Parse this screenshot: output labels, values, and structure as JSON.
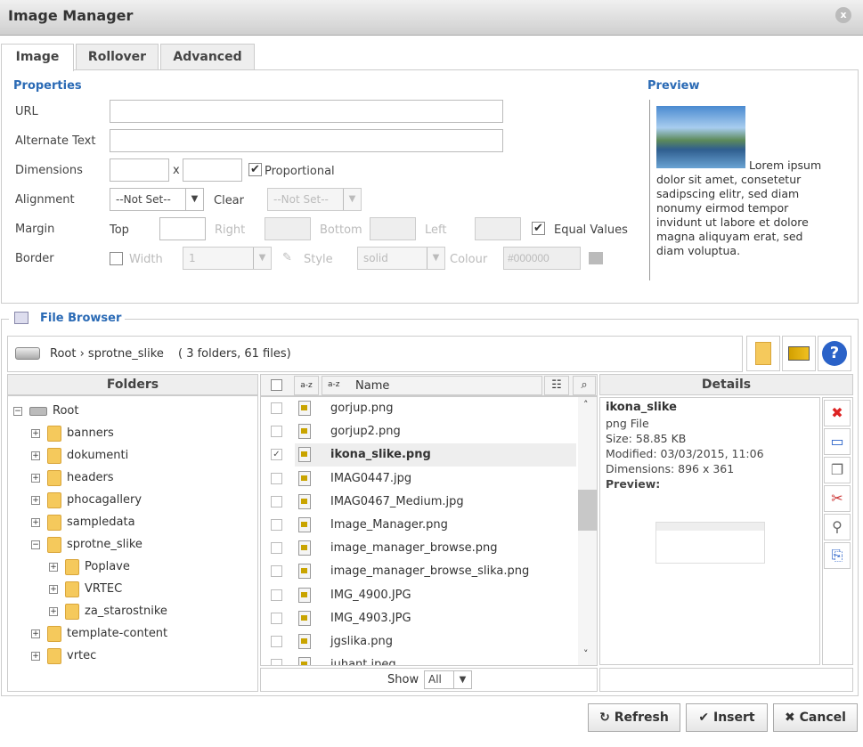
{
  "title": "Image Manager",
  "tabs": [
    "Image",
    "Rollover",
    "Advanced"
  ],
  "properties": {
    "heading": "Properties",
    "url_label": "URL",
    "url_value": "",
    "alt_label": "Alternate Text",
    "alt_value": "",
    "dimensions_label": "Dimensions",
    "width_value": "",
    "x": "x",
    "height_value": "",
    "proportional_label": "Proportional",
    "proportional_checked": true,
    "alignment_label": "Alignment",
    "alignment_value": "--Not Set--",
    "clear_label": "Clear",
    "clear_value": "--Not Set--",
    "margin_label": "Margin",
    "top": "Top",
    "right": "Right",
    "bottom": "Bottom",
    "left": "Left",
    "equal_values_label": "Equal Values",
    "equal_values_checked": true,
    "border_label": "Border",
    "border_checked": false,
    "width_label": "Width",
    "width_sel": "1",
    "style_label": "Style",
    "style_sel": "solid",
    "colour_label": "Colour",
    "colour_value": "#000000"
  },
  "preview": {
    "heading": "Preview",
    "text": "Lorem ipsum dolor sit amet, consetetur sadipscing elitr, sed diam nonumy eirmod tempor invidunt ut labore et dolore magna aliquyam erat, sed diam voluptua."
  },
  "file_browser": {
    "legend": "File Browser",
    "path": "Root › sprotne_slike",
    "counts": "( 3 folders, 61 files)",
    "folders_header": "Folders",
    "name_header": "Name",
    "details_header": "Details",
    "tree": [
      {
        "label": "Root",
        "level": 0,
        "sign": "−"
      },
      {
        "label": "banners",
        "level": 1,
        "sign": "+"
      },
      {
        "label": "dokumenti",
        "level": 1,
        "sign": "+"
      },
      {
        "label": "headers",
        "level": 1,
        "sign": "+"
      },
      {
        "label": "phocagallery",
        "level": 1,
        "sign": "+"
      },
      {
        "label": "sampledata",
        "level": 1,
        "sign": "+"
      },
      {
        "label": "sprotne_slike",
        "level": 1,
        "sign": "−"
      },
      {
        "label": "Poplave",
        "level": 2,
        "sign": "+"
      },
      {
        "label": "VRTEC",
        "level": 2,
        "sign": "+"
      },
      {
        "label": "za_starostnike",
        "level": 2,
        "sign": "+"
      },
      {
        "label": "template-content",
        "level": 1,
        "sign": "+"
      },
      {
        "label": "vrtec",
        "level": 1,
        "sign": "+"
      }
    ],
    "files": [
      {
        "name": "gorjup.png"
      },
      {
        "name": "gorjup2.png"
      },
      {
        "name": "ikona_slike.png",
        "selected": true
      },
      {
        "name": "IMAG0447.jpg"
      },
      {
        "name": "IMAG0467_Medium.jpg"
      },
      {
        "name": "Image_Manager.png"
      },
      {
        "name": "image_manager_browse.png"
      },
      {
        "name": "image_manager_browse_slika.png"
      },
      {
        "name": "IMG_4900.JPG"
      },
      {
        "name": "IMG_4903.JPG"
      },
      {
        "name": "jgslika.png"
      },
      {
        "name": "juhant.jpeg"
      }
    ],
    "show_label": "Show",
    "show_value": "All",
    "details": {
      "name": "ikona_slike",
      "type": "png File",
      "size": "Size: 58.85 KB",
      "modified": "Modified: 03/03/2015, 11:06",
      "dimensions": "Dimensions: 896 x 361",
      "preview": "Preview:"
    }
  },
  "buttons": {
    "refresh": "Refresh",
    "insert": "Insert",
    "cancel": "Cancel"
  }
}
